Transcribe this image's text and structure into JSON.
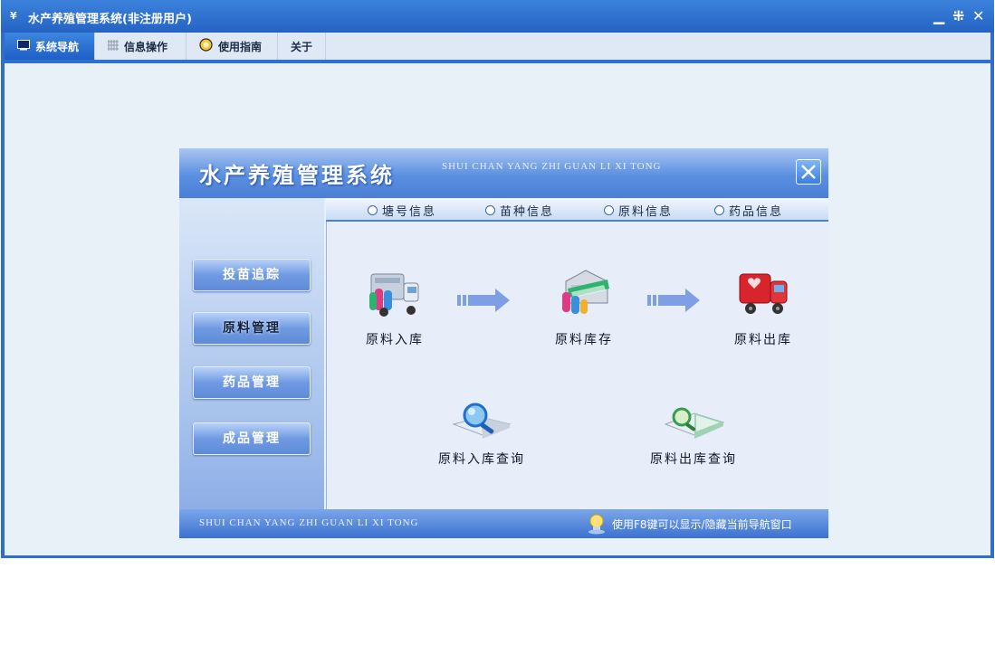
{
  "window": {
    "title": "水产养殖管理系统(非注册用户)",
    "logo": "¥",
    "controls": {
      "minimize": "▁",
      "restore": "⁜",
      "close": "✕"
    }
  },
  "menu": {
    "tabs": [
      {
        "label": "系统导航",
        "icon": "monitor-icon"
      },
      {
        "label": "信息操作",
        "icon": "grid-icon"
      },
      {
        "label": "使用指南",
        "icon": "help-icon"
      },
      {
        "label": "关于"
      }
    ],
    "active": "系统导航"
  },
  "panel": {
    "title": "水产养殖管理系统",
    "subtitle": "SHUI CHAN YANG ZHI GUAN LI XI TONG",
    "sidebar": [
      {
        "label": "投苗追踪"
      },
      {
        "label": "原料管理",
        "active": true
      },
      {
        "label": "药品管理"
      },
      {
        "label": "成品管理"
      }
    ],
    "info_tabs": [
      "塘号信息",
      "苗种信息",
      "原料信息",
      "药品信息"
    ],
    "flow": {
      "nodes": [
        {
          "label": "原料入库",
          "icon": "delivery-truck-icon"
        },
        {
          "label": "原料库存",
          "icon": "warehouse-icon"
        },
        {
          "label": "原料出库",
          "icon": "red-truck-icon"
        },
        {
          "label": "原料入库查询",
          "icon": "magnifier-book-icon"
        },
        {
          "label": "原料出库查询",
          "icon": "search-book-icon"
        }
      ]
    },
    "footer": {
      "left": "SHUI CHAN YANG ZHI GUAN LI XI TONG",
      "hint": "使用F8键可以显示/隐藏当前导航窗口"
    }
  },
  "colors": {
    "accent": "#2f6fc8",
    "panel_header": "#5a8fe0",
    "content_bg": "#e7eefa"
  }
}
